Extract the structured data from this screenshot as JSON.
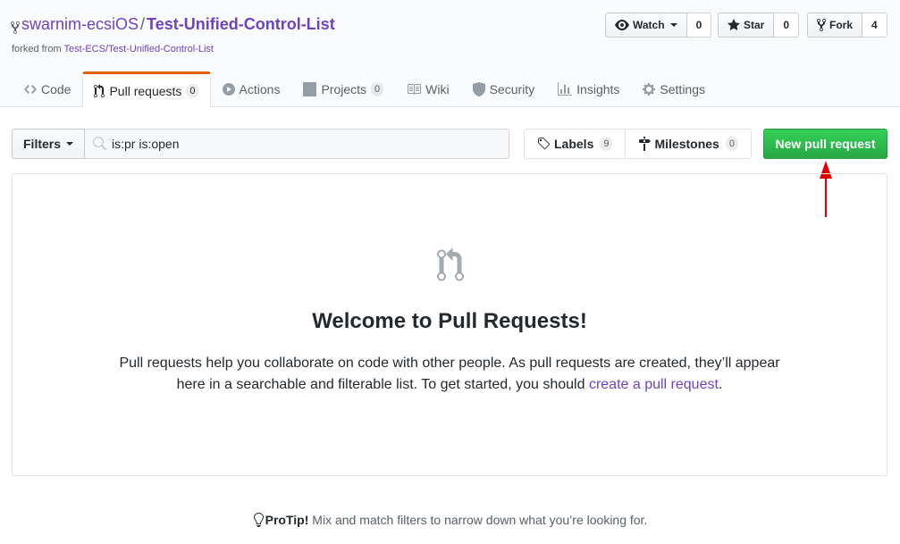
{
  "repo": {
    "owner": "swarnim-ecsiOS",
    "separator": "/",
    "name": "Test-Unified-Control-List",
    "forked_prefix": "forked from",
    "forked_source": "Test-ECS/Test-Unified-Control-List"
  },
  "social": {
    "watch_label": "Watch",
    "watch_count": "0",
    "star_label": "Star",
    "star_count": "0",
    "fork_label": "Fork",
    "fork_count": "4"
  },
  "tabs": [
    {
      "label": "Code",
      "icon": "code-icon"
    },
    {
      "label": "Pull requests",
      "count": "0",
      "icon": "git-pull-request-icon",
      "selected": true
    },
    {
      "label": "Actions",
      "icon": "play-icon"
    },
    {
      "label": "Projects",
      "count": "0",
      "icon": "project-icon"
    },
    {
      "label": "Wiki",
      "icon": "book-icon"
    },
    {
      "label": "Security",
      "icon": "shield-icon"
    },
    {
      "label": "Insights",
      "icon": "graph-icon"
    },
    {
      "label": "Settings",
      "icon": "gear-icon"
    }
  ],
  "filters": {
    "button_label": "Filters",
    "search_value": "is:pr is:open"
  },
  "labels": {
    "label": "Labels",
    "count": "9"
  },
  "milestones": {
    "label": "Milestones",
    "count": "0"
  },
  "new_pr_label": "New pull request",
  "blankslate": {
    "title": "Welcome to Pull Requests!",
    "text_before": "Pull requests help you collaborate on code with other people. As pull requests are created, they’ll appear here in a searchable and filterable list. To get started, you should ",
    "link_text": "create a pull request",
    "text_after": "."
  },
  "protip": {
    "label": "ProTip!",
    "text": " Mix and match filters to narrow down what you’re looking for."
  },
  "colors": {
    "accent_link": "#6f42c1",
    "primary_button": "#28a745",
    "selected_tab_border": "#e36209",
    "annotation_arrow": "#e00000"
  }
}
